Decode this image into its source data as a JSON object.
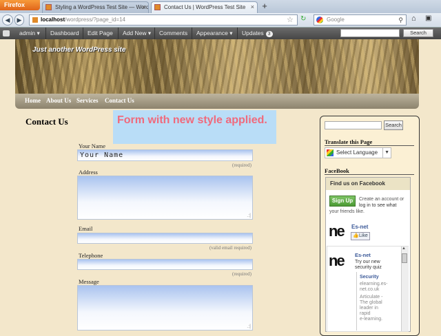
{
  "browser": {
    "menu_button": "Firefox",
    "tabs": [
      {
        "label": "Styling a WordPress Test Site — Word..."
      },
      {
        "label": "Contact Us | WordPress Test Site"
      }
    ],
    "new_tab": "+",
    "url": {
      "host": "localhost",
      "path": "/wordpress/?page_id=14"
    },
    "search_placeholder": "Google"
  },
  "admin_bar": {
    "items": [
      "admin",
      "Dashboard",
      "Edit Page",
      "Add New",
      "Comments",
      "Appearance",
      "Updates"
    ],
    "updates_count": "3",
    "search_button": "Search"
  },
  "site": {
    "tagline": "Just another WordPress site",
    "menu": [
      "Home",
      "About Us",
      "Services",
      "Contact Us"
    ]
  },
  "page": {
    "title": "Contact Us",
    "note": "Form with new style applied."
  },
  "form": {
    "name_label": "Your Name",
    "name_value": "Your Name",
    "name_hint": "(required)",
    "address_label": "Address",
    "email_label": "Email",
    "email_hint": "(valid email required)",
    "telephone_label": "Telephone",
    "telephone_hint": "(required)",
    "message_label": "Message"
  },
  "sidebar": {
    "search_button": "Search",
    "translate_heading": "Translate this Page",
    "translate_select": "Select Language",
    "facebook_heading": "FaceBook",
    "fb_find": "Find us on Facebook",
    "fb_signup": "Sign Up",
    "fb_signup_text_1": "Create an account or",
    "fb_signup_text_2": "log in to see what",
    "fb_signup_text_3": "your friends like.",
    "fb_page_name": "Es-net",
    "fb_like": "Like",
    "post_author": "Es-net",
    "post_text_1": "Try our new",
    "post_text_2": "security quiz",
    "link_title": "Security",
    "link_sub_1": "elearning.es-",
    "link_sub_2": "net.co.uk",
    "link_desc_1": "Articulate -",
    "link_desc_2": "The global",
    "link_desc_3": "leader in",
    "link_desc_4": "rapid",
    "link_desc_5": "e-learning."
  },
  "colors": {
    "note_bg": "#b9ddf7",
    "note_text": "#f06a7c",
    "page_bg": "#f3e7cb"
  }
}
